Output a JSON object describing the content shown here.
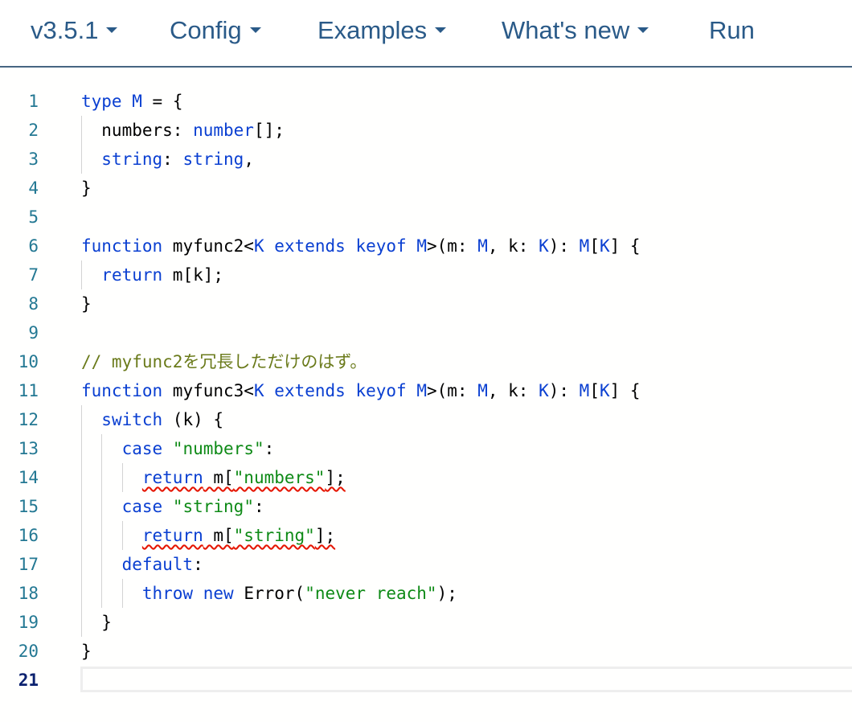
{
  "nav": {
    "items": [
      {
        "label": "v3.5.1",
        "dropdown": true
      },
      {
        "label": "Config",
        "dropdown": true
      },
      {
        "label": "Examples",
        "dropdown": true
      },
      {
        "label": "What's new",
        "dropdown": true
      },
      {
        "label": "Run",
        "dropdown": false
      }
    ],
    "accent_color": "#2a5a88"
  },
  "editor": {
    "active_line": 21,
    "line_numbers": [
      "1",
      "2",
      "3",
      "4",
      "5",
      "6",
      "7",
      "8",
      "9",
      "10",
      "11",
      "12",
      "13",
      "14",
      "15",
      "16",
      "17",
      "18",
      "19",
      "20",
      "21"
    ],
    "lines": [
      [
        {
          "t": "kw",
          "v": "type"
        },
        {
          "t": "plain",
          "v": " "
        },
        {
          "t": "type",
          "v": "M"
        },
        {
          "t": "plain",
          "v": " = {"
        }
      ],
      [
        {
          "t": "plain",
          "v": "  numbers: "
        },
        {
          "t": "kw",
          "v": "number"
        },
        {
          "t": "plain",
          "v": "[];"
        }
      ],
      [
        {
          "t": "plain",
          "v": "  "
        },
        {
          "t": "kw",
          "v": "string"
        },
        {
          "t": "plain",
          "v": ": "
        },
        {
          "t": "kw",
          "v": "string"
        },
        {
          "t": "plain",
          "v": ","
        }
      ],
      [
        {
          "t": "plain",
          "v": "}"
        }
      ],
      [],
      [
        {
          "t": "kw",
          "v": "function"
        },
        {
          "t": "plain",
          "v": " myfunc2<"
        },
        {
          "t": "type",
          "v": "K"
        },
        {
          "t": "plain",
          "v": " "
        },
        {
          "t": "kw",
          "v": "extends"
        },
        {
          "t": "plain",
          "v": " "
        },
        {
          "t": "kw",
          "v": "keyof"
        },
        {
          "t": "plain",
          "v": " "
        },
        {
          "t": "type",
          "v": "M"
        },
        {
          "t": "plain",
          "v": ">(m: "
        },
        {
          "t": "type",
          "v": "M"
        },
        {
          "t": "plain",
          "v": ", k: "
        },
        {
          "t": "type",
          "v": "K"
        },
        {
          "t": "plain",
          "v": "): "
        },
        {
          "t": "type",
          "v": "M"
        },
        {
          "t": "plain",
          "v": "["
        },
        {
          "t": "type",
          "v": "K"
        },
        {
          "t": "plain",
          "v": "] {"
        }
      ],
      [
        {
          "t": "plain",
          "v": "  "
        },
        {
          "t": "kw",
          "v": "return"
        },
        {
          "t": "plain",
          "v": " m[k];"
        }
      ],
      [
        {
          "t": "plain",
          "v": "}"
        }
      ],
      [],
      [
        {
          "t": "cm",
          "v": "// myfunc2を冗長しただけのはず。"
        }
      ],
      [
        {
          "t": "kw",
          "v": "function"
        },
        {
          "t": "plain",
          "v": " myfunc3<"
        },
        {
          "t": "type",
          "v": "K"
        },
        {
          "t": "plain",
          "v": " "
        },
        {
          "t": "kw",
          "v": "extends"
        },
        {
          "t": "plain",
          "v": " "
        },
        {
          "t": "kw",
          "v": "keyof"
        },
        {
          "t": "plain",
          "v": " "
        },
        {
          "t": "type",
          "v": "M"
        },
        {
          "t": "plain",
          "v": ">(m: "
        },
        {
          "t": "type",
          "v": "M"
        },
        {
          "t": "plain",
          "v": ", k: "
        },
        {
          "t": "type",
          "v": "K"
        },
        {
          "t": "plain",
          "v": "): "
        },
        {
          "t": "type",
          "v": "M"
        },
        {
          "t": "plain",
          "v": "["
        },
        {
          "t": "type",
          "v": "K"
        },
        {
          "t": "plain",
          "v": "] {"
        }
      ],
      [
        {
          "t": "plain",
          "v": "  "
        },
        {
          "t": "kw",
          "v": "switch"
        },
        {
          "t": "plain",
          "v": " (k) {"
        }
      ],
      [
        {
          "t": "plain",
          "v": "    "
        },
        {
          "t": "kw",
          "v": "case"
        },
        {
          "t": "plain",
          "v": " "
        },
        {
          "t": "str",
          "v": "\"numbers\""
        },
        {
          "t": "plain",
          "v": ":"
        }
      ],
      [
        {
          "t": "plain",
          "v": "      "
        },
        {
          "t": "kw",
          "v": "return",
          "err": true
        },
        {
          "t": "plain",
          "v": " m[",
          "err": true
        },
        {
          "t": "str",
          "v": "\"numbers\"",
          "err": true
        },
        {
          "t": "plain",
          "v": "];",
          "err": true
        }
      ],
      [
        {
          "t": "plain",
          "v": "    "
        },
        {
          "t": "kw",
          "v": "case"
        },
        {
          "t": "plain",
          "v": " "
        },
        {
          "t": "str",
          "v": "\"string\""
        },
        {
          "t": "plain",
          "v": ":"
        }
      ],
      [
        {
          "t": "plain",
          "v": "      "
        },
        {
          "t": "kw",
          "v": "return",
          "err": true
        },
        {
          "t": "plain",
          "v": " m[",
          "err": true
        },
        {
          "t": "str",
          "v": "\"string\"",
          "err": true
        },
        {
          "t": "plain",
          "v": "];",
          "err": true
        }
      ],
      [
        {
          "t": "plain",
          "v": "    "
        },
        {
          "t": "kw",
          "v": "default"
        },
        {
          "t": "plain",
          "v": ":"
        }
      ],
      [
        {
          "t": "plain",
          "v": "      "
        },
        {
          "t": "kw",
          "v": "throw"
        },
        {
          "t": "plain",
          "v": " "
        },
        {
          "t": "kw",
          "v": "new"
        },
        {
          "t": "plain",
          "v": " Error("
        },
        {
          "t": "str",
          "v": "\"never reach\""
        },
        {
          "t": "plain",
          "v": ");"
        }
      ],
      [
        {
          "t": "plain",
          "v": "  }"
        }
      ],
      [
        {
          "t": "plain",
          "v": "}"
        }
      ],
      []
    ],
    "colors": {
      "keyword": "#0a3fd1",
      "string": "#0e8a16",
      "comment": "#6a7a1a",
      "line_number": "#237893",
      "error_squiggle": "#e51400"
    }
  }
}
